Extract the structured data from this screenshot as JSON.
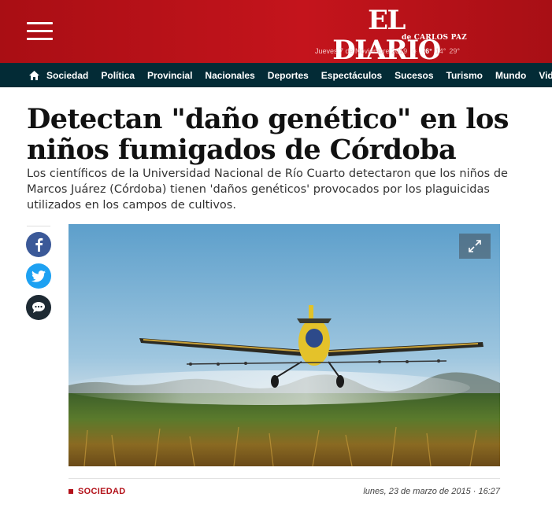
{
  "header": {
    "logo": "EL DIARIO",
    "logo_sub": "de CARLOS PAZ",
    "date": "Jueves 7 de Noviembre 2019",
    "temp_current": "26°",
    "temp_min": "14°",
    "temp_max": "29°",
    "weather_icon": "sun-icon",
    "menu_icon": "hamburger-icon"
  },
  "nav": {
    "home_icon": "home-icon",
    "items": [
      "Sociedad",
      "Política",
      "Provincial",
      "Nacionales",
      "Deportes",
      "Espectáculos",
      "Sucesos",
      "Turismo",
      "Mundo",
      "Vida"
    ]
  },
  "article": {
    "title": "Detectan \"daño genético\" en los niños fumigados de Córdoba",
    "lead": "Los científicos de la Universidad Nacional de Río Cuarto detectaron que los niños de Marcos Juárez (Córdoba) tienen 'daños genéticos' provocados por los plaguicidas utilizados en los campos de cultivos.",
    "section": "SOCIEDAD",
    "date": "lunes, 23 de marzo de 2015 · 16:27"
  },
  "share": {
    "icons": [
      "facebook-icon",
      "twitter-icon",
      "comments-icon"
    ]
  },
  "colors": {
    "brand_red": "#c4141c",
    "nav_bg": "#032b36",
    "facebook": "#3b5998",
    "twitter": "#1da1f2",
    "comments": "#1e2a33"
  }
}
